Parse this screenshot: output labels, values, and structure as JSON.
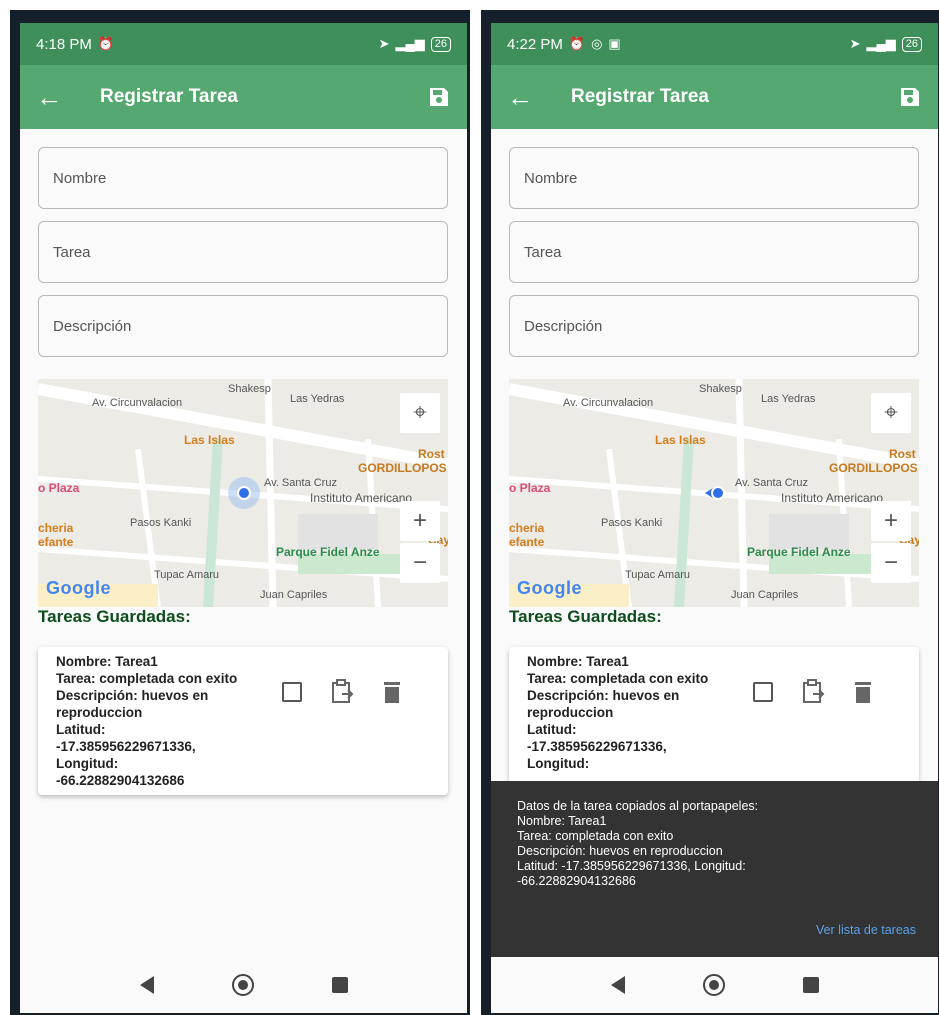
{
  "colors": {
    "statusbar": "#3f8f5a",
    "appbar": "#56a871",
    "section_title": "#0d4d1d",
    "snackbar": "#333333",
    "snackbar_action": "#5aa3ea"
  },
  "left": {
    "status": {
      "time": "4:18 PM",
      "battery": "26"
    },
    "appbar": {
      "title": "Registrar Tarea",
      "back_icon": "arrow-left-icon",
      "save_icon": "save-icon"
    },
    "fields": {
      "nombre": "Nombre",
      "tarea": "Tarea",
      "descripcion": "Descripción"
    },
    "map": {
      "streets": [
        "Av. Circunvalacion",
        "Shakesp",
        "Las Yedras",
        "Av. Santa Cruz",
        "Pasos Kanki",
        "Tupac Amaru",
        "Juan Capriles"
      ],
      "pois": [
        "Las Islas",
        "GORDILLOPOS",
        "Instituto Americano",
        "o Plaza",
        "cheria",
        "efante",
        "Parque Fidel Anze",
        "Rost",
        "Cay"
      ],
      "google": "Google"
    },
    "section": "Tareas Guardadas:",
    "card": {
      "lines": [
        "Nombre: Tarea1",
        "Tarea: completada con exito",
        "Descripción: huevos en",
        "reproduccion",
        "Latitud:",
        "-17.385956229671336,",
        "Longitud:",
        "-66.22882904132686"
      ]
    }
  },
  "right": {
    "status": {
      "time": "4:22 PM",
      "battery": "26"
    },
    "appbar": {
      "title": "Registrar Tarea"
    },
    "fields": {
      "nombre": "Nombre",
      "tarea": "Tarea",
      "descripcion": "Descripción"
    },
    "section": "Tareas Guardadas:",
    "card": {
      "lines": [
        "Nombre: Tarea1",
        "Tarea: completada con exito",
        "Descripción: huevos en",
        "reproduccion",
        "Latitud:",
        "-17.385956229671336,",
        "Longitud:"
      ]
    },
    "snackbar": {
      "message": "Datos de la tarea copiados al portapapeles:\nNombre: Tarea1\nTarea: completada con exito\nDescripción: huevos en reproduccion\nLatitud: -17.385956229671336, Longitud:\n-66.22882904132686",
      "action": "Ver lista de tareas"
    }
  }
}
